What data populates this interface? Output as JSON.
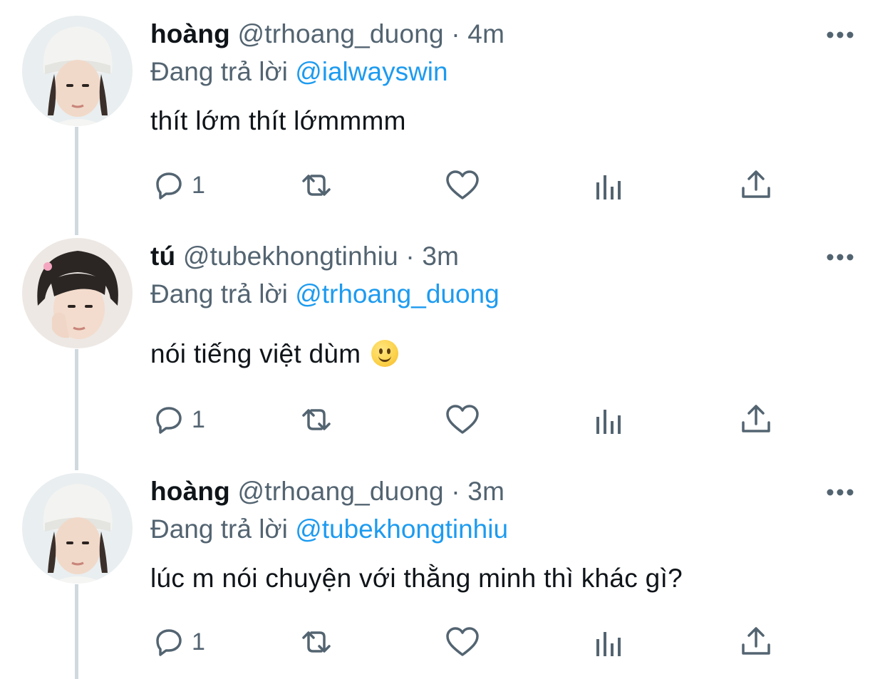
{
  "tweets": [
    {
      "name": "hoàng",
      "handle": "@trhoang_duong",
      "separator": "·",
      "time": "4m",
      "reply_prefix": "Đang trả lời",
      "reply_to": "@ialwayswin",
      "text": "thít lớm thít lớmmmm",
      "has_emoji": false,
      "reply_count": "1",
      "avatar_icon": "avatar-white-beanie"
    },
    {
      "name": "tú",
      "handle": "@tubekhongtinhiu",
      "separator": "·",
      "time": "3m",
      "reply_prefix": "Đang trả lời",
      "reply_to": "@trhoang_duong",
      "text": "nói tiếng việt dùm",
      "has_emoji": true,
      "emoji_name": "slightly-smiling-face-emoji",
      "reply_count": "1",
      "avatar_icon": "avatar-dark-hair"
    },
    {
      "name": "hoàng",
      "handle": "@trhoang_duong",
      "separator": "·",
      "time": "3m",
      "reply_prefix": "Đang trả lời",
      "reply_to": "@tubekhongtinhiu",
      "text": "lúc m nói chuyện với thằng minh thì khác gì?",
      "has_emoji": false,
      "reply_count": "1",
      "avatar_icon": "avatar-white-beanie"
    }
  ],
  "colors": {
    "text": "#0f1419",
    "secondary": "#536471",
    "accent": "#1d9bf0",
    "thread_line": "#cfd9de"
  }
}
